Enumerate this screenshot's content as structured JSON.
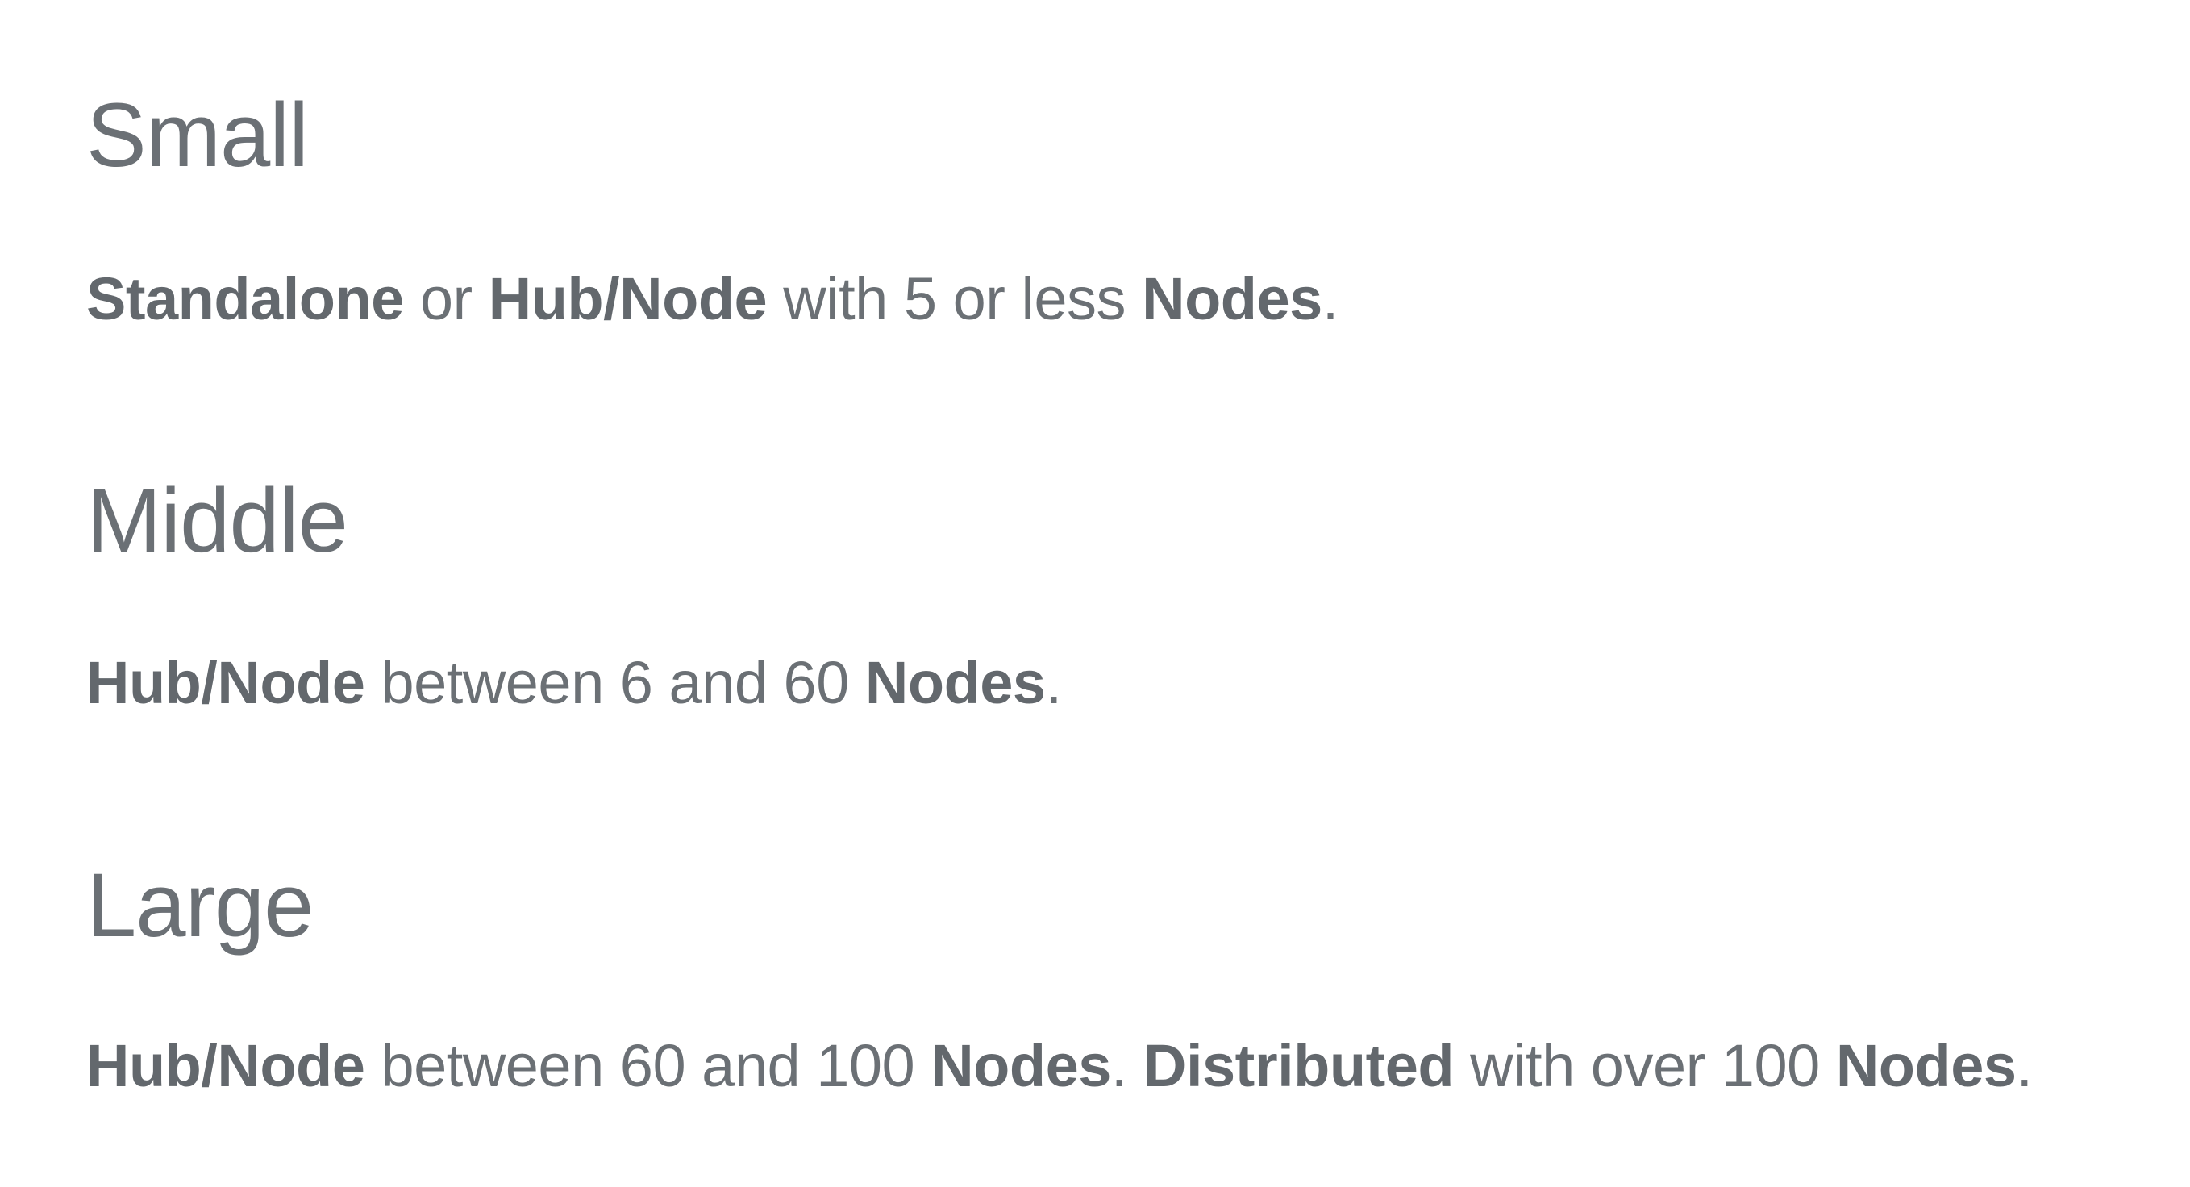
{
  "sections": [
    {
      "title": "Small",
      "description": [
        {
          "text": "Standalone",
          "bold": true
        },
        {
          "text": " or ",
          "bold": false
        },
        {
          "text": "Hub/Node",
          "bold": true
        },
        {
          "text": " with 5 or less ",
          "bold": false
        },
        {
          "text": "Nodes",
          "bold": true
        },
        {
          "text": ".",
          "bold": false
        }
      ]
    },
    {
      "title": "Middle",
      "description": [
        {
          "text": "Hub/Node",
          "bold": true
        },
        {
          "text": " between 6 and 60 ",
          "bold": false
        },
        {
          "text": "Nodes",
          "bold": true
        },
        {
          "text": ".",
          "bold": false
        }
      ]
    },
    {
      "title": "Large",
      "description": [
        {
          "text": "Hub/Node",
          "bold": true
        },
        {
          "text": " between 60 and 100 ",
          "bold": false
        },
        {
          "text": "Nodes",
          "bold": true
        },
        {
          "text": ". ",
          "bold": false
        },
        {
          "text": "Distributed",
          "bold": true
        },
        {
          "text": " with over 100 ",
          "bold": false
        },
        {
          "text": "Nodes",
          "bold": true
        },
        {
          "text": ".",
          "bold": false
        }
      ]
    }
  ],
  "colors": {
    "text": "#6b7075",
    "bold_text": "#63686d",
    "background": "#ffffff"
  }
}
